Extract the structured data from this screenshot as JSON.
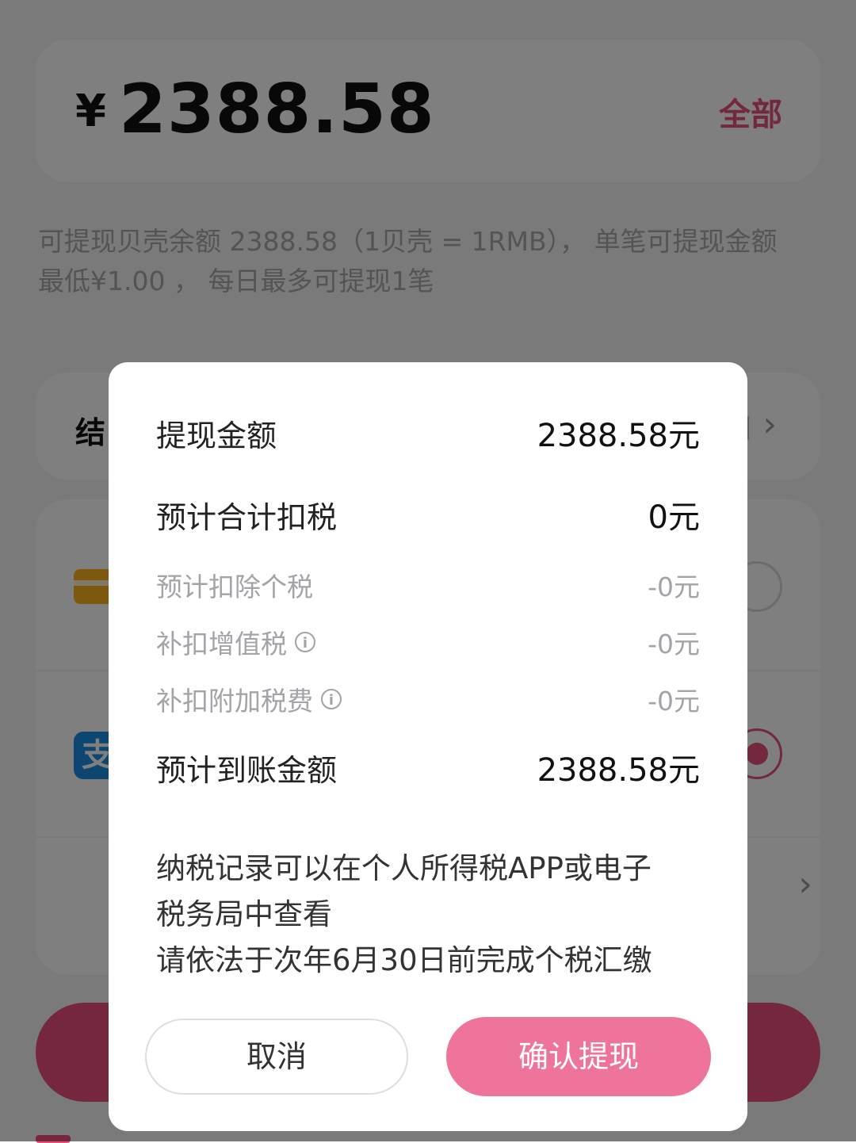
{
  "background": {
    "currency_symbol": "¥",
    "amount": "2388.58",
    "all_label": "全部",
    "info_line1": "可提现贝壳余额 2388.58（1贝壳 = 1RMB）， 单笔可提现金额",
    "info_line2": "最低¥1.00 ， 每日最多可提现1笔",
    "settlement_label": "结",
    "alipay_glyph": "支"
  },
  "dialog": {
    "rows": {
      "withdraw_amount": {
        "label": "提现金额",
        "value": "2388.58元"
      },
      "total_tax": {
        "label": "预计合计扣税",
        "value": "0元"
      },
      "income_tax": {
        "label": "预计扣除个税",
        "value": "-0元"
      },
      "vat": {
        "label": "补扣增值税",
        "value": "-0元"
      },
      "surcharge": {
        "label": "补扣附加税费",
        "value": "-0元"
      },
      "arrival_amount": {
        "label": "预计到账金额",
        "value": "2388.58元"
      }
    },
    "notice_line1": "纳税记录可以在个人所得税APP或电子",
    "notice_line2": "税务局中查看",
    "notice_line3": "请依法于次年6月30日前完成个税汇缴",
    "cancel_label": "取消",
    "confirm_label": "确认提现"
  },
  "colors": {
    "accent": "#ea4f7c",
    "confirm_button": "#ee7599",
    "overlay": "rgba(0,0,0,0.5)"
  }
}
